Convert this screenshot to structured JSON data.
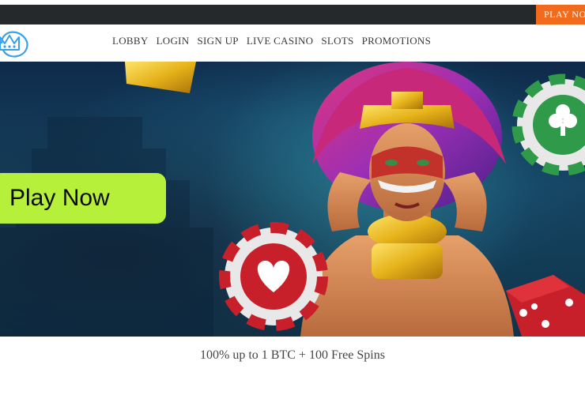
{
  "topbar": {
    "play_now_label": "PLAY NOW"
  },
  "nav": {
    "items": [
      {
        "label": "LOBBY"
      },
      {
        "label": "LOGIN"
      },
      {
        "label": "SIGN UP"
      },
      {
        "label": "LIVE CASINO"
      },
      {
        "label": "SLOTS"
      },
      {
        "label": "PROMOTIONS"
      }
    ]
  },
  "hero": {
    "cta_label": "Play Now"
  },
  "promo": {
    "tagline": "100% up to 1 BTC + 100 Free Spins"
  },
  "colors": {
    "accent_orange": "#f26a1b",
    "cta_green": "#b7f03a",
    "topbar_dark": "#26292c",
    "logo_blue": "#3aa0e8"
  }
}
